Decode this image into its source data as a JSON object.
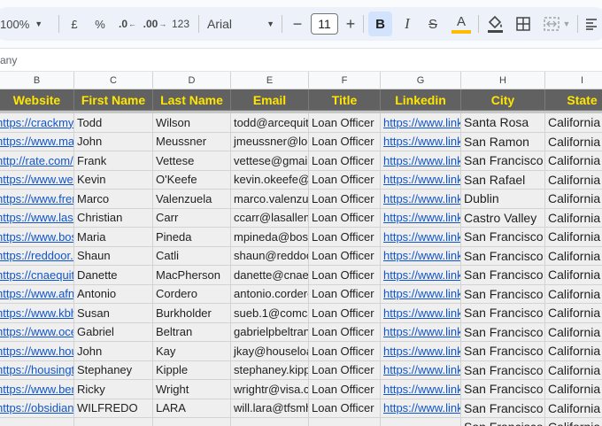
{
  "toolbar": {
    "zoom": "100%",
    "currency": "£",
    "percent": "%",
    "decrease_decimal": ".0",
    "increase_decimal": ".00",
    "number_format": "123",
    "font_family": "Arial",
    "minus": "−",
    "font_size": "11",
    "plus": "+",
    "bold": "B",
    "italic": "I",
    "strike": "S",
    "text_color": "A",
    "text_color_bar": "#fbbc04",
    "active_button_bg": "#d3e3fd"
  },
  "formula_bar": {
    "content": "any"
  },
  "columns": [
    "B",
    "C",
    "D",
    "E",
    "F",
    "G",
    "H",
    "I"
  ],
  "headers": [
    "Website",
    "First Name",
    "Last Name",
    "Email",
    "Title",
    "Linkedin",
    "City",
    "State"
  ],
  "header_colors": {
    "background": "#616161",
    "text": "#ffe600"
  },
  "rows": [
    [
      "https://crackmyc",
      "Todd",
      "Wilson",
      "todd@arcequity",
      "Loan Officer",
      "https://www.link",
      "Santa Rosa",
      "California"
    ],
    [
      "https://www.mas",
      "John",
      "Meussner",
      "jmeussner@lou",
      "Loan Officer",
      "https://www.link",
      "San Ramon",
      "California"
    ],
    [
      "http://rate.com/",
      "Frank",
      "Vettese",
      "vettese@gmail.",
      "Loan Officer",
      "https://www.link",
      "San Francisco",
      "California"
    ],
    [
      "https://www.welc",
      "Kevin",
      "O'Keefe",
      "kevin.okeefe@",
      "Loan Officer",
      "https://www.link",
      "San Rafael",
      "California"
    ],
    [
      "https://www.frem",
      "Marco",
      "Valenzuela",
      "marco.valenzue",
      "Loan Officer",
      "https://www.link",
      "Dublin",
      "California"
    ],
    [
      "https://www.lasa",
      "Christian",
      "Carr",
      "ccarr@lasallem",
      "Loan Officer",
      "https://www.link",
      "Castro Valley",
      "California"
    ],
    [
      "https://www.bost",
      "Maria",
      "Pineda",
      "mpineda@bost",
      "Loan Officer",
      "https://www.link",
      "San Francisco",
      "California"
    ],
    [
      "https://reddoor.c",
      "Shaun",
      "Catli",
      "shaun@reddoo",
      "Loan Officer",
      "https://www.link",
      "San Francisco",
      "California"
    ],
    [
      "https://cnaequity",
      "Danette",
      "MacPherson",
      "danette@cnaec",
      "Loan Officer",
      "https://www.link",
      "San Francisco",
      "California"
    ],
    [
      "https://www.afnc",
      "Antonio",
      "Cordero",
      "antonio.corderc",
      "Loan Officer",
      "https://www.link",
      "San Francisco",
      "California"
    ],
    [
      "https://www.kbhs",
      "Susan",
      "Burkholder",
      "sueb.1@comca",
      "Loan Officer",
      "https://www.link",
      "San Francisco",
      "California"
    ],
    [
      "https://www.ocea",
      "Gabriel",
      "Beltran",
      "gabrielpbeltran",
      "Loan Officer",
      "https://www.link",
      "San Francisco",
      "California"
    ],
    [
      "https://www.hous",
      "John",
      "Kay",
      "jkay@houseloa",
      "Loan Officer",
      "https://www.link",
      "San Francisco",
      "California"
    ],
    [
      "https://housingtr",
      "Stephaney",
      "Kipple",
      "stephaney.kipp",
      "Loan Officer",
      "https://www.link",
      "San Francisco",
      "California"
    ],
    [
      "https://www.benc",
      "Ricky",
      "Wright",
      "wrightr@visa.cc",
      "Loan Officer",
      "https://www.link",
      "San Francisco",
      "California"
    ],
    [
      "https://obsidianfi",
      "WILFREDO",
      "LARA",
      "will.lara@tfsmh",
      "Loan Officer",
      "https://www.link",
      "San Francisco",
      "California"
    ],
    [
      "",
      "",
      "",
      "",
      "",
      "",
      "San Francisco",
      "California"
    ]
  ]
}
